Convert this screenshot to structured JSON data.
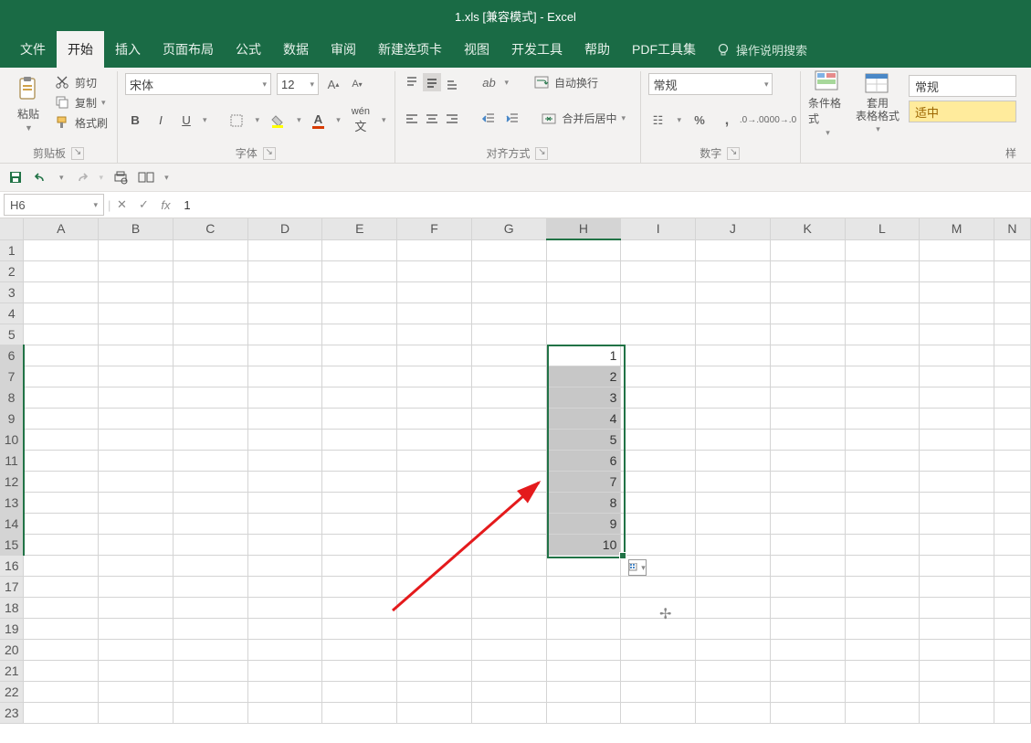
{
  "title": "1.xls  [兼容模式]  -  Excel",
  "tabs": [
    "文件",
    "开始",
    "插入",
    "页面布局",
    "公式",
    "数据",
    "审阅",
    "新建选项卡",
    "视图",
    "开发工具",
    "帮助",
    "PDF工具集"
  ],
  "active_tab_index": 1,
  "tell_me": "操作说明搜索",
  "clipboard": {
    "paste": "粘贴",
    "cut": "剪切",
    "copy": "复制",
    "painter": "格式刷",
    "label": "剪贴板"
  },
  "font": {
    "name": "宋体",
    "size": "12",
    "label": "字体"
  },
  "align": {
    "wrap": "自动换行",
    "merge": "合并后居中",
    "label": "对齐方式"
  },
  "number": {
    "format": "常规",
    "label": "数字"
  },
  "styles": {
    "cond": "条件格式",
    "table": "套用\n表格格式",
    "normal": "常规",
    "neutral": "适中",
    "label": "样"
  },
  "namebox": "H6",
  "formula_value": "1",
  "columns": [
    "A",
    "B",
    "C",
    "D",
    "E",
    "F",
    "G",
    "H",
    "I",
    "J",
    "K",
    "L",
    "M",
    "N"
  ],
  "active_col": "H",
  "rows": 23,
  "sel_start_row": 6,
  "sel_end_row": 15,
  "data_cells": {
    "6": "1",
    "7": "2",
    "8": "3",
    "9": "4",
    "10": "5",
    "11": "6",
    "12": "7",
    "13": "8",
    "14": "9",
    "15": "10"
  },
  "col_widths": {
    "row": 26,
    "A": 82,
    "B": 82,
    "C": 82,
    "D": 82,
    "E": 82,
    "F": 82,
    "G": 82,
    "H": 82,
    "I": 82,
    "J": 82,
    "K": 82,
    "L": 82,
    "M": 82,
    "N": 40
  }
}
